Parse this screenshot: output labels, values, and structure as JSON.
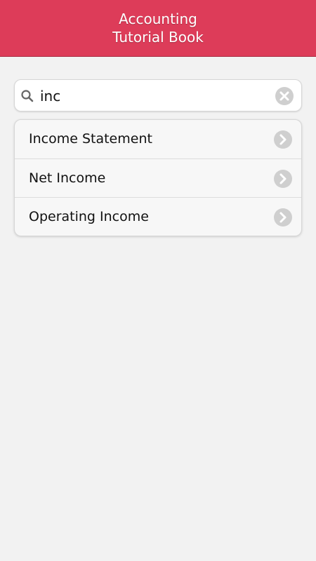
{
  "header": {
    "title_line1": "Accounting",
    "title_line2": "Tutorial Book"
  },
  "search": {
    "value": "inc",
    "icon": "search-icon",
    "clear_icon": "clear-icon"
  },
  "results": [
    {
      "label": "Income Statement",
      "icon": "chevron-right-icon"
    },
    {
      "label": "Net Income",
      "icon": "chevron-right-icon"
    },
    {
      "label": "Operating Income",
      "icon": "chevron-right-icon"
    }
  ],
  "colors": {
    "header_bg": "#dd3c59",
    "page_bg": "#f2f2f2",
    "icon_gray": "#cfcfcf"
  }
}
